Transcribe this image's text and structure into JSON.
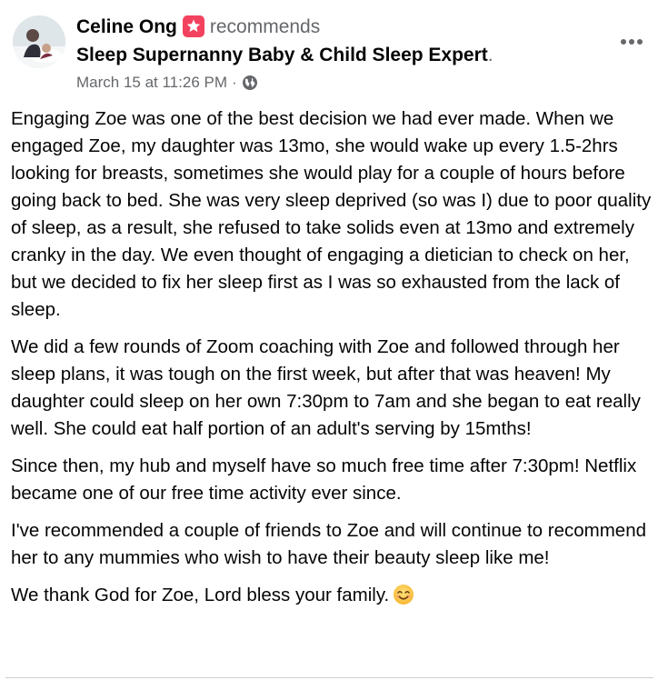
{
  "post": {
    "author": "Celine Ong",
    "action": "recommends",
    "page_name": "Sleep Supernanny Baby & Child Sleep Expert",
    "page_suffix": ".",
    "timestamp": "March 15 at 11:26 PM",
    "separator": "·",
    "audience_icon": "globe-icon",
    "recommend_icon": "star-recommend-icon",
    "paragraphs": [
      "Engaging Zoe was one of the best decision we had ever made. When we engaged Zoe, my daughter was 13mo, she would wake up every 1.5-2hrs looking for breasts, sometimes she would play for a couple of hours before going back to bed. She was very sleep deprived (so was I) due to poor quality of sleep, as a result, she refused to take solids even at 13mo and extremely cranky in the day. We even thought of engaging a dietician to check on her, but we decided to fix her sleep first as I was so exhausted from the lack of sleep.",
      "We did a few rounds of Zoom coaching with Zoe and followed through her sleep plans, it was tough on the first week, but after that was heaven! My daughter could sleep on her own 7:30pm to 7am and she began to eat really well. She could eat half portion of an adult's serving by 15mths!",
      "Since then, my hub and myself have so much free time after 7:30pm! Netflix became one of our free time activity ever since.",
      "I've recommended a couple of friends to Zoe and will continue to recommend her to any mummies who wish to have their beauty sleep like me!",
      "We thank God for Zoe, Lord bless your family."
    ],
    "last_emoji": "smiling-face-icon"
  },
  "colors": {
    "text": "#050505",
    "secondary_text": "#65676b",
    "recommend_badge": "#f3425f",
    "divider": "#ced0d4"
  }
}
